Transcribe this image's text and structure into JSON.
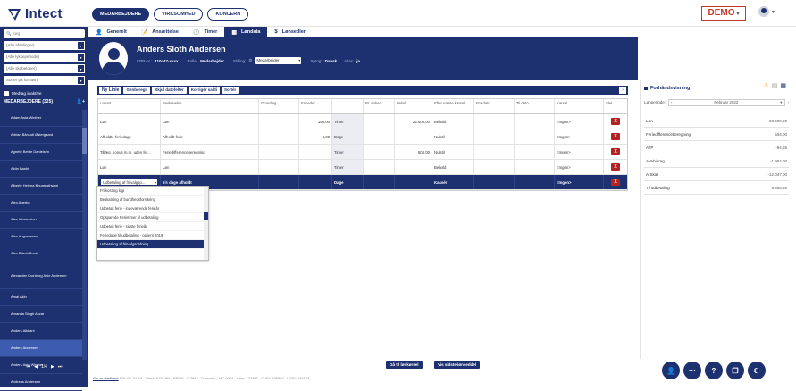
{
  "app": {
    "logo_text": "Intect"
  },
  "top_tabs": [
    {
      "label": "MEDARBEJDERE",
      "active": true
    },
    {
      "label": "VIRKSOMHED",
      "active": false
    },
    {
      "label": "KONCERN",
      "active": false
    }
  ],
  "demo_label": "DEMO",
  "sidebar": {
    "search_placeholder": "Søg",
    "filters": [
      "(Alle afdelinger)",
      "(Alle lykkeperiode)",
      "(Alle skabeloner)",
      "Sorter på fornavn"
    ],
    "inactive_label": "Medtag inaktive",
    "count_label": "MEDARBEJDERE (325)",
    "employees": [
      "Adam Asta Winther",
      "Adrian Bänkuti Østergaard",
      "Agnete Bente Danielsen",
      "Aldin Bashir",
      "Alberte Helena Bhumesthwari",
      "Alex Agerbo",
      "Alex Athanasiou",
      "Alex Augustesen",
      "Alex Bitsch Buch",
      "Alexander Kronborg Ahle Andersen",
      "Amal Akin",
      "Amanda Singh Akzar",
      "Anders Albilani",
      "Anders Andersen",
      "Anders Asta Winther",
      "Andreas Andersen"
    ],
    "selected_index": 13,
    "pager": {
      "first": "⏮",
      "prev": "◀",
      "page": "1/4",
      "next": "▶",
      "last": "⏭"
    }
  },
  "subnav": [
    {
      "label": "Generelt",
      "icon": "person-icon",
      "glyph": "👤",
      "active": false
    },
    {
      "label": "Ansættelse",
      "icon": "contract-icon",
      "glyph": "📝",
      "active": false
    },
    {
      "label": "Timer",
      "icon": "clock-icon",
      "glyph": "🕒",
      "active": false
    },
    {
      "label": "Løndata",
      "icon": "table-icon",
      "glyph": "▦",
      "active": true
    },
    {
      "label": "Lønsedler",
      "icon": "dollar-icon",
      "glyph": "$",
      "active": false
    }
  ],
  "header": {
    "name": "Anders Sloth Andersen",
    "cpr_label": "CPR-nr.:",
    "cpr_value": "110447-xxxx",
    "role_label": "Rolle:",
    "role_value": "Medarbejder",
    "position_label": "Stilling:",
    "position_value": "Medarbejder",
    "language_label": "Sprog:",
    "language_value": "Dansk",
    "alias_label": "Alias:",
    "alias_value": "ja"
  },
  "toolbar": [
    "Ny Linie",
    "Genberegn",
    "Skjul datofelter",
    "Korrigér saldi",
    "Sortér"
  ],
  "grid": {
    "columns": [
      "Lønart",
      "Beskrivelse",
      "Grundlag",
      "Enheder",
      "",
      "Pr. enhed",
      "Beløb",
      "Efter næste kørsel",
      "Fra dato",
      "Til dato",
      "Kørsel",
      "Slet"
    ],
    "rows": [
      [
        "Løn",
        "Løn",
        "",
        "150,00",
        "Timer",
        "",
        "23.400,00",
        "Behold",
        "",
        "",
        "<Ingen>",
        "X"
      ],
      [
        "Afholdte feriedage",
        "Afholdt ferie",
        "",
        "4,00",
        "Dage",
        "",
        "",
        "Nulstil",
        "",
        "",
        "<Ingen>",
        "X"
      ],
      [
        "Tillæg, bonus m.m. uden fer...",
        "Feriedifferenceberegning",
        "",
        "",
        "Timer",
        "",
        "504,00",
        "Nulstil",
        "",
        "",
        "<Ingen>",
        "X"
      ],
      [
        "Løn",
        "Løn",
        "",
        "",
        "Timer",
        "",
        "",
        "Behold",
        "",
        "",
        "<Ingen>",
        "X"
      ],
      [
        "Udbetaling af fritvalgsp...",
        "5½ dage afholdt",
        "",
        "",
        "Dage",
        "",
        "",
        "Kassér",
        "",
        "",
        "<Ingen>",
        "X"
      ]
    ]
  },
  "dropdown": {
    "items": [
      "Fri kost og logi",
      "Beskatning af bundhedsforsikring",
      "Udbetalt ferie - indeværende ferieår",
      "Opsparede Ferietimer til udbetaling",
      "Udbetalt ferie - sidste ferieår",
      "Feriedage til udbetaling - optjent 2019",
      "Udbetaling af fritvalgsordning"
    ],
    "active_index": 6
  },
  "preview": {
    "title": "Forhåndsvisning",
    "period_label": "Lønperiode:",
    "period_value": "Februar 2022",
    "rows": [
      {
        "label": "Løn",
        "value": "23.400,00"
      },
      {
        "label": "Feriedifferenceberegning",
        "value": "504,00"
      },
      {
        "label": "ATP",
        "value": "-94,65"
      },
      {
        "label": "AM-bidrag",
        "value": "-1.904,00"
      },
      {
        "label": "A-Skat",
        "value": "-12.047,00"
      },
      {
        "label": "Til udbetaling",
        "value": "9.858,35"
      }
    ]
  },
  "bottom": {
    "btn1": "Gå til lønkørsel",
    "btn2": "Vis sidste lønseddel",
    "feedback_link": "Giv os feedback",
    "footer_info": "API: 6.1.51.44 - Client: 5.01.468 - PROD - IT2844 - Danmark - MC 0972 - User: 132386 - CUID: 156562 - USID: 154193"
  },
  "colors": {
    "primary": "#1d3070",
    "danger": "#b22222",
    "warning": "#f39c12"
  }
}
